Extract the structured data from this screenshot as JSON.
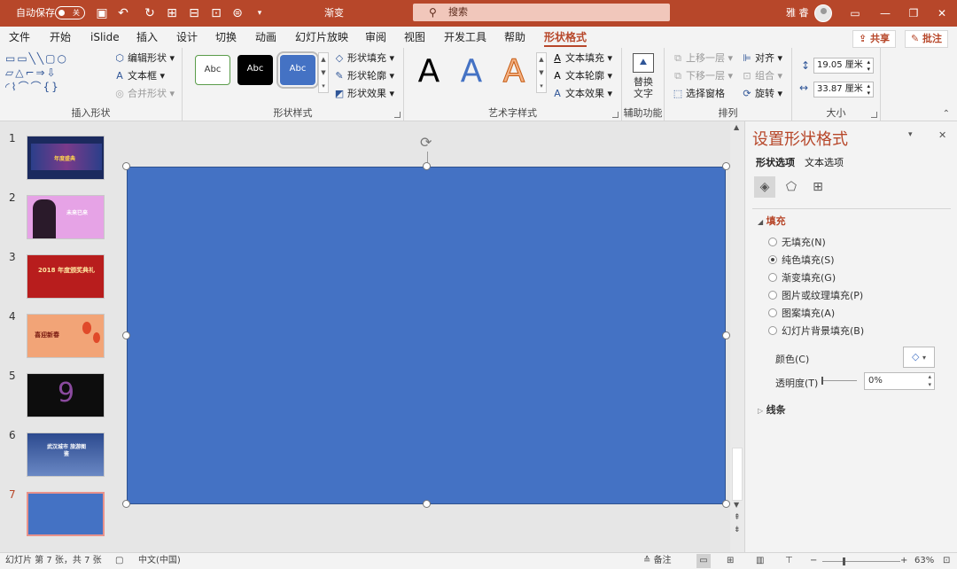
{
  "titlebar": {
    "autosave_label": "自动保存",
    "autosave_state": "关",
    "doc_title": "渐变",
    "search_placeholder": "搜索",
    "user_name": "雅 睿",
    "bg_color": "#b7472a"
  },
  "tabs": [
    "文件",
    "开始",
    "iSlide",
    "插入",
    "设计",
    "切换",
    "动画",
    "幻灯片放映",
    "审阅",
    "视图",
    "开发工具",
    "帮助",
    "形状格式"
  ],
  "active_tab": "形状格式",
  "top_actions": {
    "share": "共享",
    "comment": "批注"
  },
  "ribbon": {
    "insert_shapes": {
      "label": "插入形状",
      "edit_shape": "编辑形状",
      "text_box": "文本框",
      "merge_shapes": "合并形状"
    },
    "shape_styles": {
      "label": "形状样式",
      "preset": "Abc",
      "fill": "形状填充",
      "outline": "形状轮廓",
      "effect": "形状效果"
    },
    "wordart": {
      "label": "艺术字样式",
      "letter": "A",
      "text_fill": "文本填充",
      "text_outline": "文本轮廓",
      "text_effect": "文本效果"
    },
    "accessibility": {
      "label": "辅助功能",
      "alt_text_1": "替换",
      "alt_text_2": "文字"
    },
    "arrange": {
      "label": "排列",
      "bring_forward": "上移一层",
      "send_backward": "下移一层",
      "selection_pane": "选择窗格",
      "align": "对齐",
      "group": "组合",
      "rotate": "旋转"
    },
    "size": {
      "label": "大小",
      "height": "19.05 厘米",
      "width": "33.87 厘米"
    }
  },
  "slides": [
    {
      "num": "1",
      "text": "年度盛典",
      "bg": "#1b2a5e"
    },
    {
      "num": "2",
      "text": "未来已来",
      "bg": "#e6a3e6"
    },
    {
      "num": "3",
      "text": "2018 年度颁奖典礼",
      "bg": "#b81d1d"
    },
    {
      "num": "4",
      "text": "喜迎新春",
      "bg": "#f2a477"
    },
    {
      "num": "5",
      "text": "9",
      "bg": "#0d0d0d"
    },
    {
      "num": "6",
      "text": "武汉城市 旅游图鉴",
      "bg": "#2c4a8f"
    },
    {
      "num": "7",
      "text": "",
      "bg": "#4472c4"
    }
  ],
  "active_slide": "7",
  "canvas": {
    "shape_fill": "#4472c4"
  },
  "pane": {
    "title": "设置形状格式",
    "tab_shape": "形状选项",
    "tab_text": "文本选项",
    "section_fill": "填充",
    "options": [
      "无填充(N)",
      "纯色填充(S)",
      "渐变填充(G)",
      "图片或纹理填充(P)",
      "图案填充(A)",
      "幻灯片背景填充(B)"
    ],
    "selected_option": "纯色填充(S)",
    "color_label": "颜色(C)",
    "transparency_label": "透明度(T)",
    "transparency_value": "0%",
    "section_line": "线条"
  },
  "status": {
    "slide_info": "幻灯片 第 7 张，共 7 张",
    "language": "中文(中国)",
    "notes": "备注",
    "zoom": "63%"
  }
}
